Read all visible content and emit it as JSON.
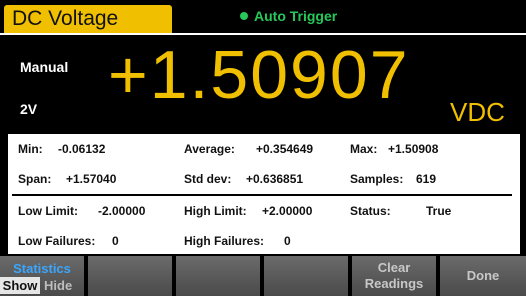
{
  "header": {
    "mode_label": "DC Voltage",
    "trigger_label": "Auto Trigger",
    "trigger_color": "#27c85a",
    "accent_color": "#f0c000"
  },
  "main_display": {
    "range_mode": "Manual",
    "range_value": "2V",
    "reading": "+1.50907",
    "unit": "VDC"
  },
  "statistics": {
    "row1": {
      "min_label": "Min:",
      "min_value": "-0.06132",
      "avg_label": "Average:",
      "avg_value": "+0.354649",
      "max_label": "Max:",
      "max_value": "+1.50908"
    },
    "row2": {
      "span_label": "Span:",
      "span_value": "+1.57040",
      "std_label": "Std dev:",
      "std_value": "+0.636851",
      "samples_label": "Samples:",
      "samples_value": "619"
    },
    "row3": {
      "low_limit_label": "Low Limit:",
      "low_limit_value": "-2.00000",
      "high_limit_label": "High Limit:",
      "high_limit_value": "+2.00000",
      "status_label": "Status:",
      "status_value": "True"
    },
    "row4": {
      "low_fail_label": "Low Failures:",
      "low_fail_value": "0",
      "high_fail_label": "High Failures:",
      "high_fail_value": "0"
    }
  },
  "softkeys": {
    "statistics": {
      "title": "Statistics",
      "show": "Show",
      "hide": "Hide",
      "selected": "Show"
    },
    "clear_line1": "Clear",
    "clear_line2": "Readings",
    "done": "Done"
  }
}
